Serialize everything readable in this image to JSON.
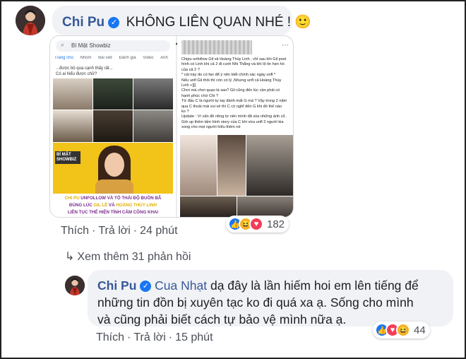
{
  "comment1": {
    "author": "Chi Pu",
    "verified_icon": "✓",
    "text": "KHÔNG LIÊN QUAN NHÉ ! 🙂",
    "attachment": {
      "left_panel": {
        "search_text": "Bí Mật Showbiz",
        "tabs": [
          "Trang chủ",
          "Nhóm",
          "Bài viết",
          "Đánh giá",
          "Video",
          "Ảnh"
        ],
        "post_text_1": "...được bỏ qua cạnh thấy rất...",
        "post_text_2": "Có ai hiểu được chữ?",
        "page_logo": "BÍ MẬT SHOWBIZ",
        "caption_line1_a": "CHI PU",
        "caption_line1_b": " UNFOLLOW VÀ TỎ THÁI ĐỘ BUỒN BÃ",
        "caption_line2_a": "ĐÚNG LÚC ",
        "caption_line2_b": "GIL LÊ",
        "caption_line2_c": " VÀ ",
        "caption_line2_d": "HOÀNG THÙY LINH",
        "caption_line3": "LIÊN TỤC THỂ HIỆN TÌNH CẢM CÔNG KHAI"
      },
      "right_panel": {
        "lines": [
          "Chipu unfollow Gil và Hoàng Thùy Linh , chỉ sau khi Gil post",
          "hình có Linh khi cả 2 đi cưới Nhi Thắng và khi lộ tin hẹn hò",
          "của cả 2 ?",
          "* cái này do có fan để ý nên biết chính xác ngày unfl *",
          "Nếu unfl Gil thôi thì còn có lý ,Nhưng unfl cả Hoàng Thùy",
          "Linh +]]]",
          "Chơi mà chơi quạo là sao? Gil cũng đến lúc cần phải có",
          "hạnh phúc chứ Chi ?",
          "Từ đầu C là người tự tay đánh mất G mà ? Vậy trong 2 năm",
          "qua C thoải mái vui vẻ thì C có nghĩ đến G khi đó thế nào",
          "ko ?",
          "Update : Vì vấn đề riêng tư nên mình đã xóa những ảnh cũ .",
          "Giờ up thêm tấm hình story của C khi vừa unfl 2 người kia",
          "xong cho mọi người hiểu thêm nè"
        ]
      }
    },
    "actions": {
      "like": "Thích",
      "reply": "Trả lời",
      "time": "24 phút"
    },
    "reaction_count": "182",
    "more_replies": "Xem thêm 31 phản hồi"
  },
  "comment2": {
    "author": "Chi Pu",
    "verified_icon": "✓",
    "mention": "Cua Nhạt",
    "text_line1": " dạ đây là lần hiếm hoi em lên tiếng để",
    "text_line2": "những tin đồn bị xuyên tạc ko đi quá xa ạ. Sống cho mình",
    "text_line3": "và cũng phải biết cách tự bảo vệ mình nữa ạ.",
    "actions": {
      "like": "Thích",
      "reply": "Trả lời",
      "time": "15 phút"
    },
    "reaction_count": "44"
  },
  "reaction_icons": {
    "like": "👍",
    "haha": "😆",
    "love": "♥"
  },
  "colors": {
    "name": "#385898",
    "bubble": "#f0f2f5",
    "like": "#1877f2",
    "love": "#f33e58",
    "haha": "#f7b125",
    "caption_yellow": "#f5d010",
    "caption_purple": "#7b2d8e"
  }
}
